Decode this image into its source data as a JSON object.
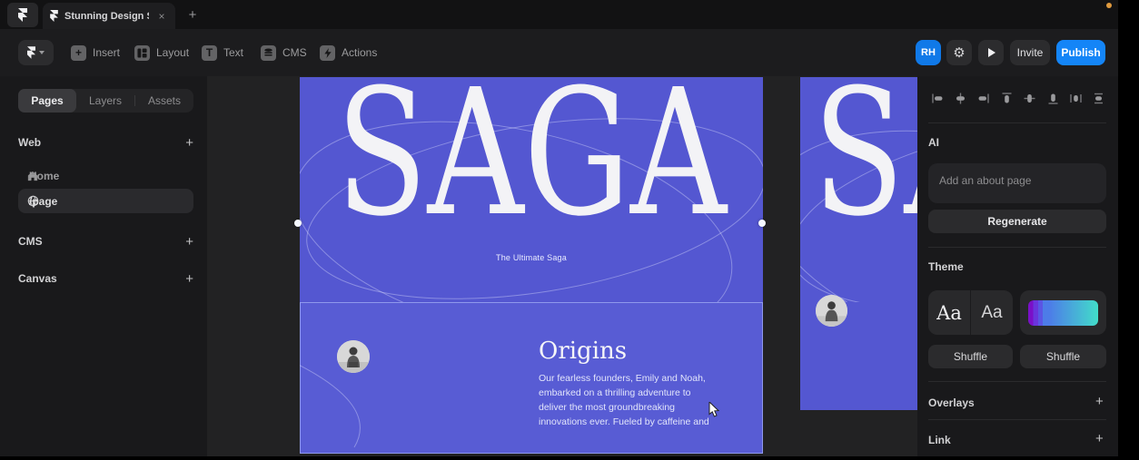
{
  "tabbar": {
    "title": "Stunning Design S.",
    "close": "×",
    "new_tab": "+"
  },
  "toolbar": {
    "title": "Stunning Design Subscription",
    "items": [
      {
        "label": "Insert",
        "icon": "plus-icon"
      },
      {
        "label": "Layout",
        "icon": "layout-icon"
      },
      {
        "label": "Text",
        "icon": "text-icon"
      },
      {
        "label": "CMS",
        "icon": "database-icon"
      },
      {
        "label": "Actions",
        "icon": "lightning-icon"
      }
    ],
    "avatar_initials": "RH",
    "invite": "Invite",
    "publish": "Publish",
    "accent_color": "#1485f7"
  },
  "sidebar": {
    "tabs": [
      {
        "label": "Pages",
        "active": true
      },
      {
        "label": "Layers",
        "active": false
      },
      {
        "label": "Assets",
        "active": false
      }
    ],
    "web": {
      "label": "Web",
      "add": "+"
    },
    "pages": [
      {
        "label": "Home",
        "icon": "home-icon",
        "selected": false
      },
      {
        "label": "/page",
        "icon": "globe-icon",
        "selected": true
      }
    ],
    "cms": {
      "label": "CMS",
      "add": "+"
    },
    "canvas_section": {
      "label": "Canvas",
      "add": "+"
    }
  },
  "canvas": {
    "frame_color": "#5457d1",
    "origins_color": "#585cd4",
    "page": {
      "hero_title": "SAGA",
      "tagline": "The Ultimate Saga",
      "origins": {
        "heading": "Origins",
        "body": "Our fearless founders, Emily and Noah, embarked on a thrilling adventure to deliver the most groundbreaking innovations ever. Fueled by caffeine and"
      }
    }
  },
  "panel": {
    "ai": {
      "label": "AI",
      "placeholder": "Add an about page",
      "regenerate": "Regenerate"
    },
    "theme": {
      "label": "Theme",
      "serif_sample": "Aa",
      "sans_sample": "Aa",
      "shuffle_font": "Shuffle",
      "shuffle_color": "Shuffle",
      "gradient": [
        "#7a10c8",
        "#6a35dc",
        "#5b55e4",
        "#4d7ce8",
        "#42ddc9"
      ]
    },
    "overlays": {
      "label": "Overlays",
      "add": "+"
    },
    "link": {
      "label": "Link",
      "add": "+"
    }
  }
}
